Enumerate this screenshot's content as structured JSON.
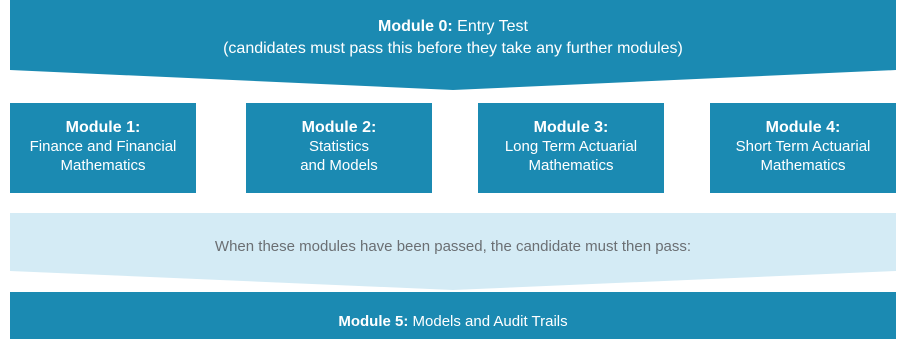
{
  "colors": {
    "primary": "#1b8ab2",
    "light": "#d4ebf5",
    "muted_text": "#6b6f73",
    "on_primary": "#ffffff"
  },
  "entry": {
    "module_label": "Module 0:",
    "name": "Entry Test",
    "note": "(candidates must pass this before they take any further modules)"
  },
  "modules": [
    {
      "label": "Module 1:",
      "line1": "Finance and Financial",
      "line2": "Mathematics"
    },
    {
      "label": "Module 2:",
      "line1": "Statistics",
      "line2": "and Models"
    },
    {
      "label": "Module 3:",
      "line1": "Long Term Actuarial",
      "line2": "Mathematics"
    },
    {
      "label": "Module 4:",
      "line1": "Short Term Actuarial",
      "line2": "Mathematics"
    }
  ],
  "condition": {
    "text": "When these modules have been passed, the candidate must then pass:"
  },
  "final": {
    "module_label": "Module 5:",
    "name": "Models and Audit Trails"
  }
}
